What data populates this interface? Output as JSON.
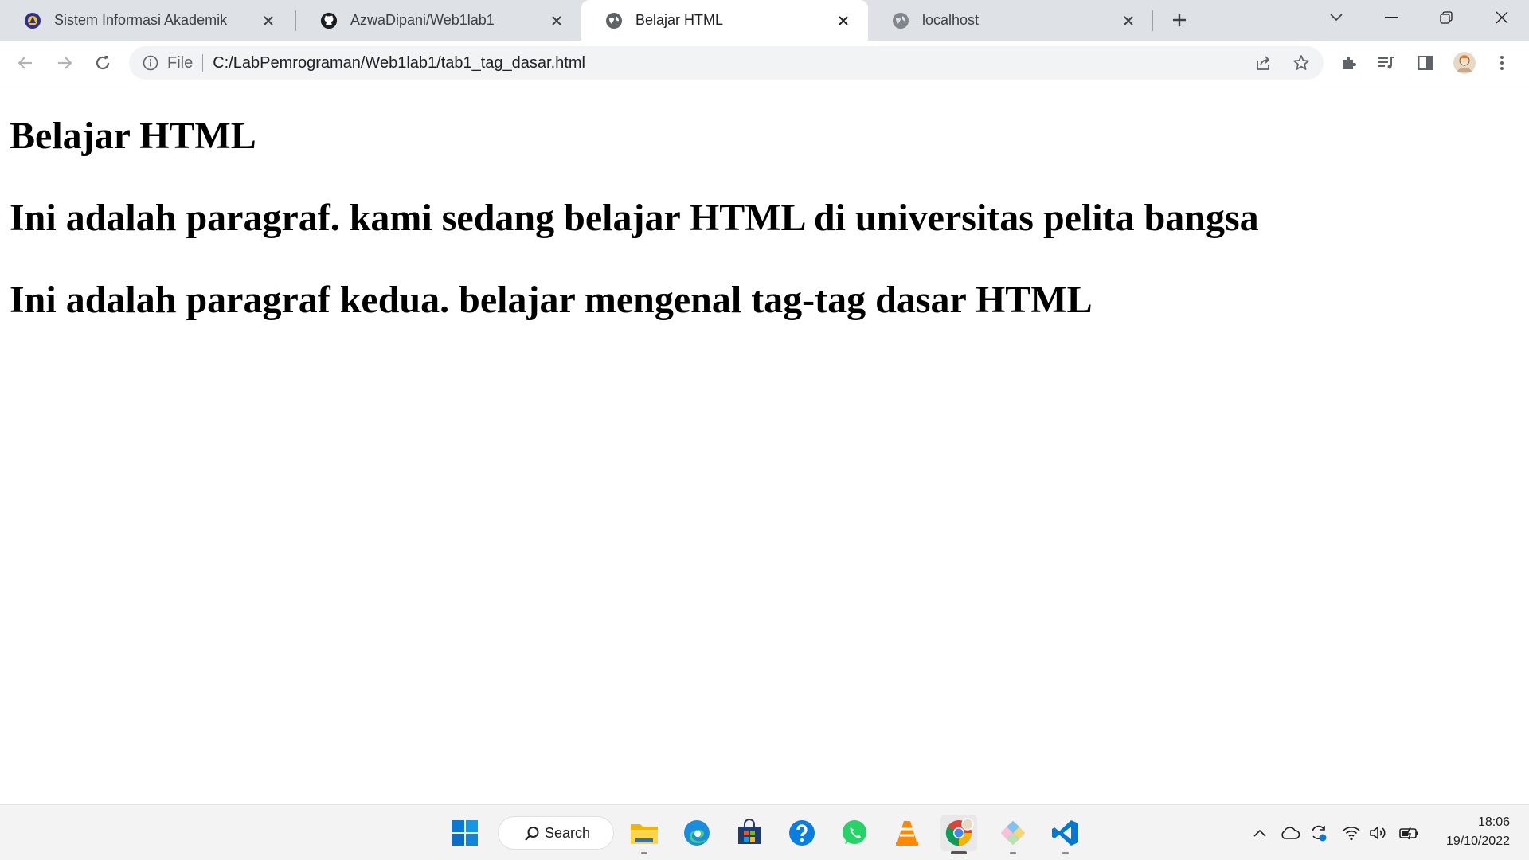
{
  "browser": {
    "tabs": [
      {
        "title": "Sistem Informasi Akademik",
        "icon": "university-logo-icon"
      },
      {
        "title": "AzwaDipani/Web1lab1",
        "icon": "github-icon"
      },
      {
        "title": "Belajar HTML",
        "icon": "globe-icon",
        "active": true
      },
      {
        "title": "localhost",
        "icon": "globe-icon"
      }
    ],
    "address_bar": {
      "scheme_label": "File",
      "url": "C:/LabPemrograman/Web1lab1/tab1_tag_dasar.html"
    }
  },
  "page": {
    "heading": "Belajar HTML",
    "paragraph1": "Ini adalah paragraf. kami sedang belajar HTML di universitas pelita bangsa",
    "paragraph2": "Ini adalah paragraf kedua. belajar mengenal tag-tag dasar HTML"
  },
  "taskbar": {
    "search_label": "Search",
    "apps": [
      "start-icon",
      "file-explorer-icon",
      "edge-icon",
      "microsoft-store-icon",
      "help-icon",
      "whatsapp-icon",
      "vlc-icon",
      "chrome-icon",
      "git-icon",
      "vscode-icon"
    ],
    "clock_time": "18:06",
    "clock_date": "19/10/2022"
  },
  "colors": {
    "tabstrip_bg": "#dee1e6",
    "omnibox_bg": "#f1f3f4",
    "taskbar_bg": "#f3f3f3"
  }
}
